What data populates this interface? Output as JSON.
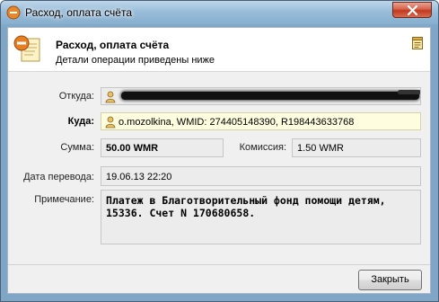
{
  "window": {
    "title": "Расход, оплата счёта"
  },
  "header": {
    "title": "Расход, оплата счёта",
    "subtitle": "Детали операции приведены ниже"
  },
  "form": {
    "from_label": "Откуда:",
    "from_value": "",
    "to_label": "Куда:",
    "to_value": "o.mozolkina, WMID: 274405148390, R198443633768",
    "amount_label": "Сумма:",
    "amount_value": "50.00 WMR",
    "commission_label": "Комиссия:",
    "commission_value": "1.50 WMR",
    "date_label": "Дата перевода:",
    "date_value": "19.06.13 22:20",
    "note_label": "Примечание:",
    "note_value": "Платеж в Благотворительный фонд помощи детям, 15336. Счет N 170680658."
  },
  "buttons": {
    "close_label": "Закрыть"
  },
  "colors": {
    "titlebar": "#97bbd8",
    "close_button": "#c2391f",
    "recipient_field": "#fffde0",
    "redaction": "#101010"
  },
  "icons": {
    "title": "payment-icon",
    "header": "payment-icon",
    "receipt": "receipt-icon",
    "wallet_from": "wallet-icon",
    "wallet_to": "wallet-icon",
    "close": "close-icon"
  }
}
